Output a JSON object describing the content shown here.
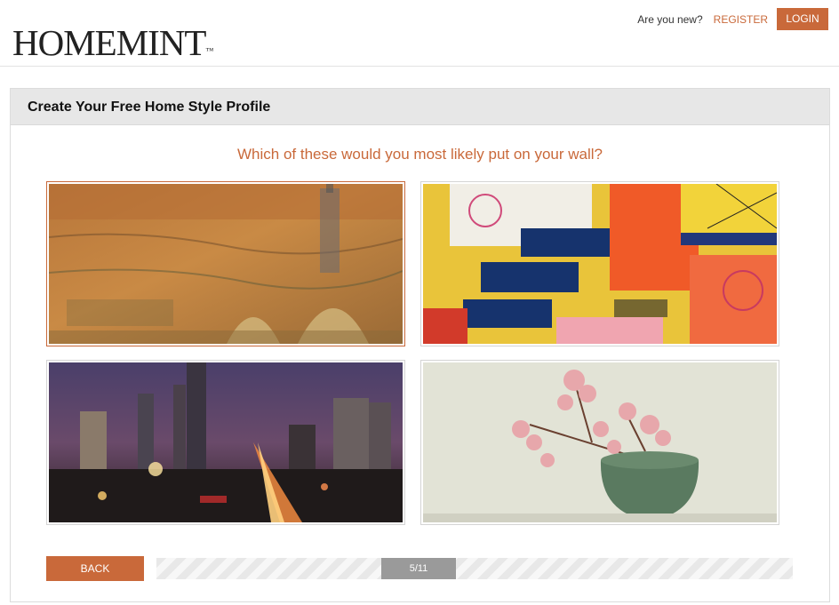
{
  "brand": {
    "logo": "HOMEMINT",
    "tm": "™"
  },
  "topnav": {
    "question": "Are you new?",
    "register": "REGISTER",
    "login": "LOGIN"
  },
  "panel": {
    "title": "Create Your Free Home Style Profile",
    "question": "Which of these would you most likely put on your wall?"
  },
  "options": [
    {
      "name": "option-vintage-city-painting",
      "selected": true
    },
    {
      "name": "option-abstract-collage",
      "selected": false
    },
    {
      "name": "option-city-night-photo",
      "selected": false
    },
    {
      "name": "option-cherry-blossom-vase",
      "selected": false
    }
  ],
  "progress": {
    "back": "BACK",
    "label": "5/11",
    "current": 5,
    "total": 11
  },
  "colors": {
    "accent": "#c9693a",
    "progress_fill": "#9a9a9a",
    "panel_header": "#e7e7e7"
  }
}
